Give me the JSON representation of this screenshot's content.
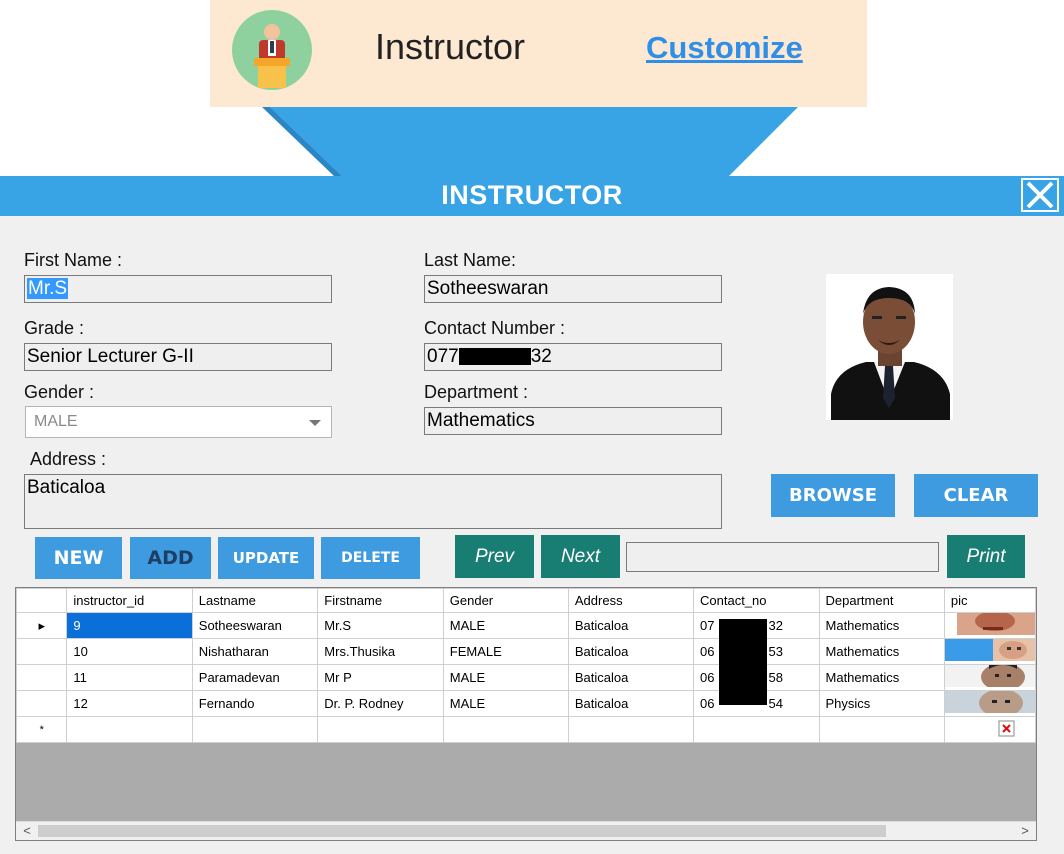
{
  "banner": {
    "title": "Instructor",
    "link": "Customize",
    "avatar_icon": "instructor-podium-icon"
  },
  "window": {
    "title": "INSTRUCTOR",
    "close_icon": "close-icon"
  },
  "form": {
    "first_name_label": "First Name :",
    "first_name_value": "Mr.S",
    "last_name_label": "Last Name:",
    "last_name_value": "Sotheeswaran",
    "grade_label": "Grade :",
    "grade_value": "Senior Lecturer G-II",
    "contact_label": "Contact Number :",
    "contact_prefix": "077",
    "contact_suffix": "32",
    "gender_label": "Gender :",
    "gender_value": "MALE",
    "department_label": "Department :",
    "department_value": "Mathematics",
    "address_label": "Address :",
    "address_value": "Baticaloa"
  },
  "buttons": {
    "browse": "BROWSE",
    "clear": "CLEAR",
    "new": "NEW",
    "add": "ADD",
    "update": "UPDATE",
    "delete": "DELETE",
    "prev": "Prev",
    "next": "Next",
    "print": "Print",
    "search_value": ""
  },
  "grid": {
    "columns": [
      "instructor_id",
      "Lastname",
      "Firstname",
      "Gender",
      "Address",
      "Contact_no",
      "Department",
      "pic"
    ],
    "rows": [
      {
        "id": "9",
        "lastname": "Sotheeswaran",
        "firstname": "Mr.S",
        "gender": "MALE",
        "address": "Baticaloa",
        "contact_prefix": "07",
        "contact_suffix": "32",
        "department": "Mathematics"
      },
      {
        "id": "10",
        "lastname": "Nishatharan",
        "firstname": "Mrs.Thusika",
        "gender": "FEMALE",
        "address": "Baticaloa",
        "contact_prefix": "06",
        "contact_suffix": "53",
        "department": "Mathematics"
      },
      {
        "id": "11",
        "lastname": "Paramadevan",
        "firstname": "Mr  P",
        "gender": "MALE",
        "address": "Baticaloa",
        "contact_prefix": "06",
        "contact_suffix": "58",
        "department": "Mathematics"
      },
      {
        "id": "12",
        "lastname": "Fernando",
        "firstname": "Dr.  P.  Rodney",
        "gender": "MALE",
        "address": "Baticaloa",
        "contact_prefix": "06",
        "contact_suffix": "54",
        "department": "Physics"
      }
    ],
    "current_row_marker": "▸",
    "new_row_marker": "*",
    "scroll_left": "<",
    "scroll_right": ">"
  },
  "colors": {
    "accent": "#38a3e5",
    "button_blue": "#3f9be0",
    "button_teal": "#187d73",
    "banner_bg": "#fde9d2",
    "link": "#2f8fe8"
  }
}
